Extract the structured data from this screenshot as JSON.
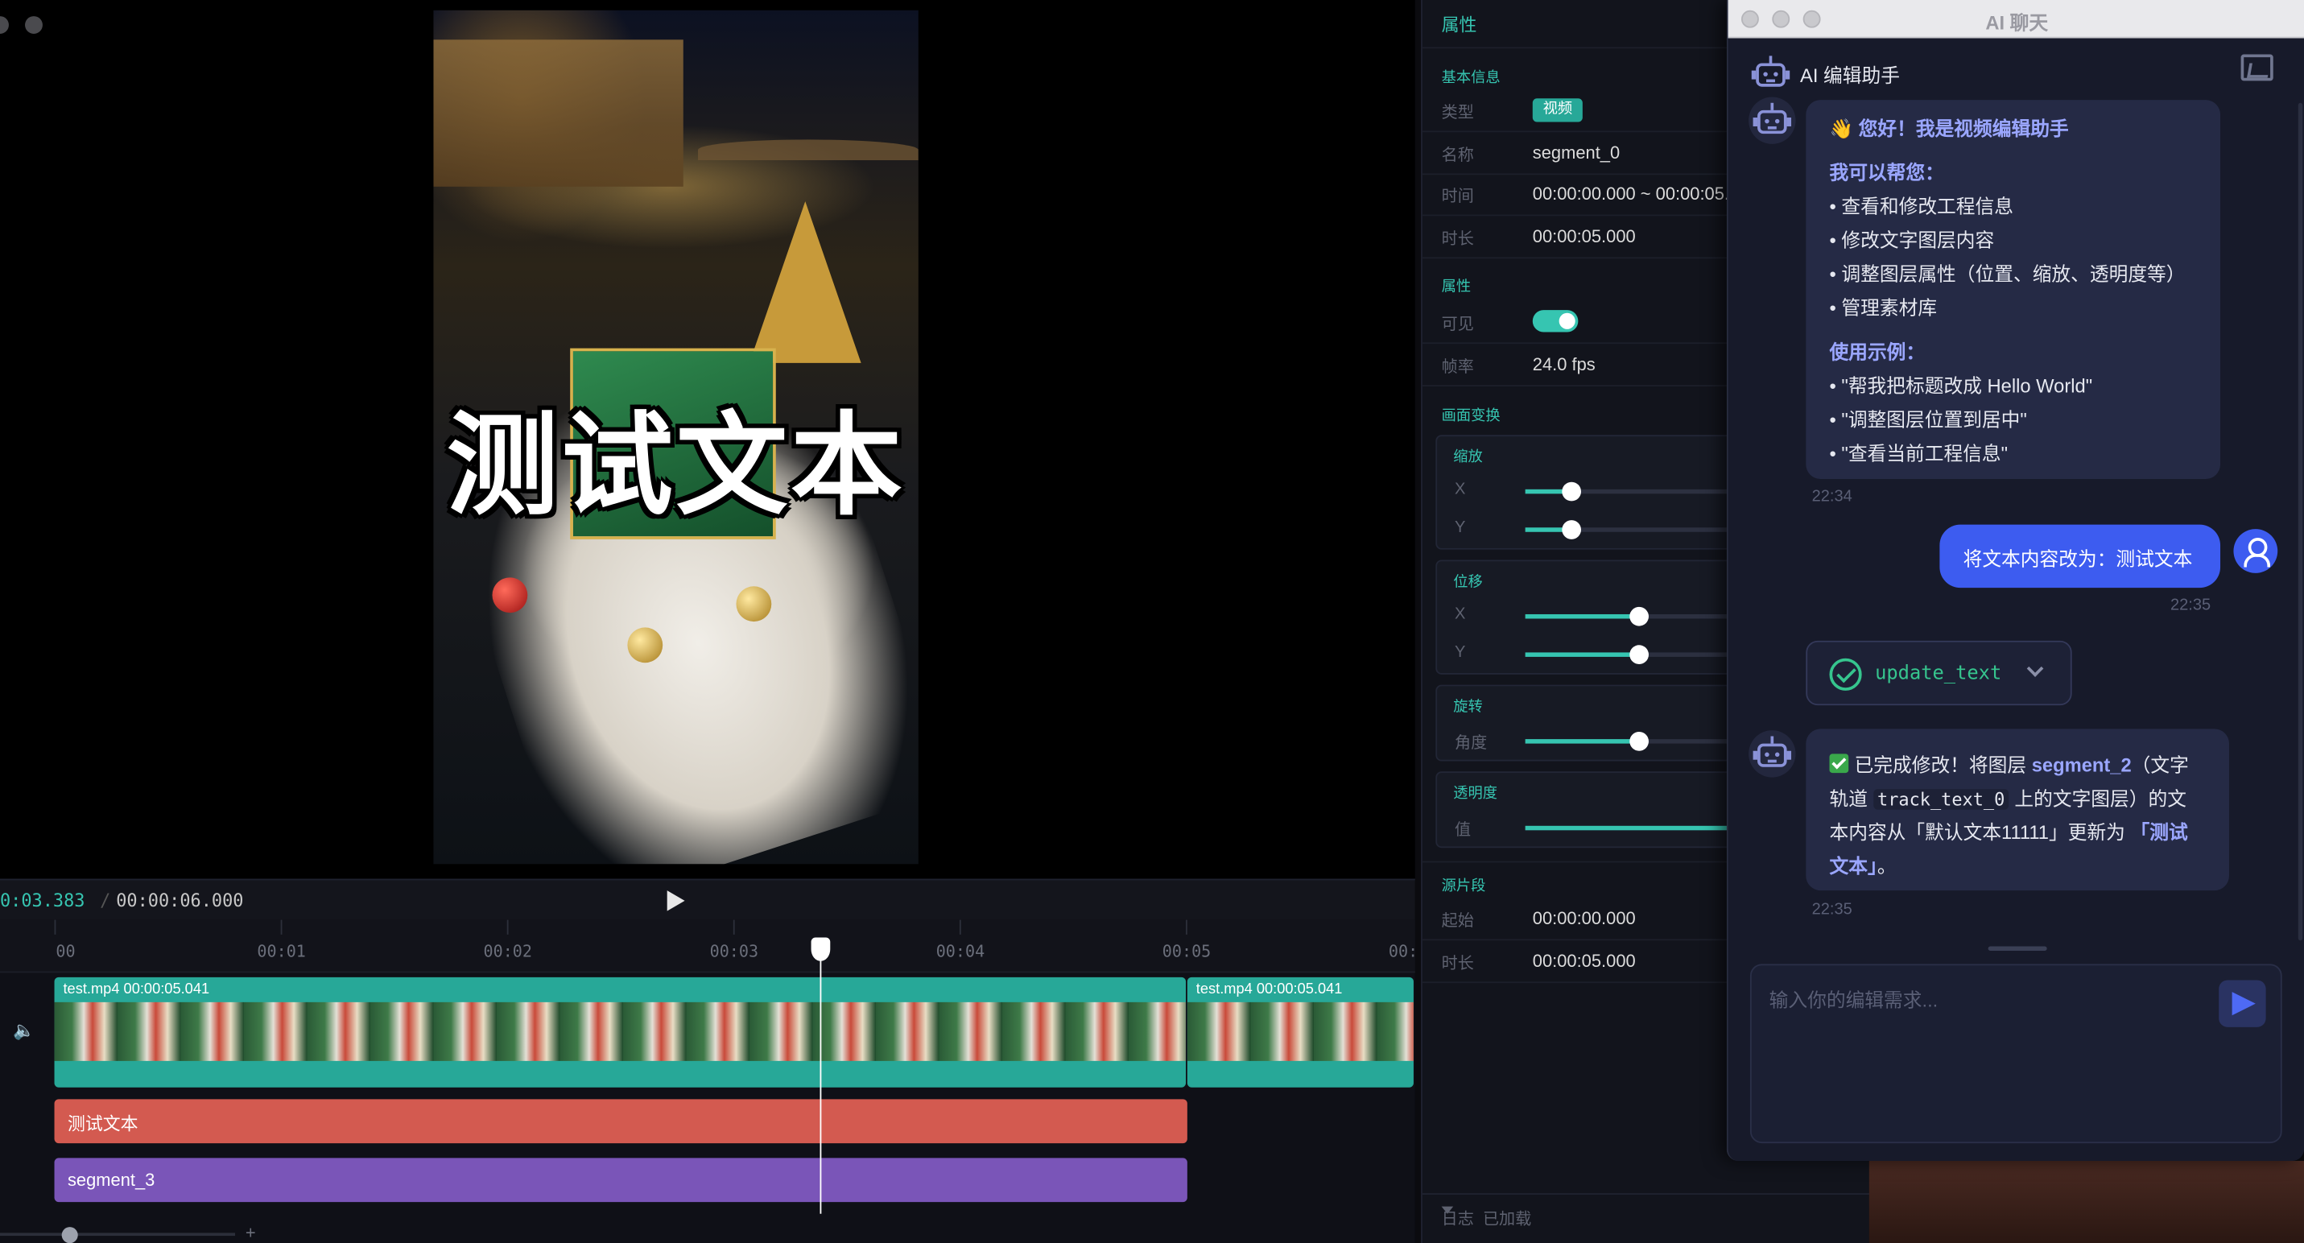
{
  "editor": {
    "overlay_text": "测试文本",
    "time_current": "0:03.383",
    "time_separator": "/",
    "time_total": "00:00:06.000",
    "ruler_ticks": [
      "00",
      "00:01",
      "00:02",
      "00:03",
      "00:04",
      "00:05",
      "00:"
    ],
    "clips": {
      "video_1_label": "test.mp4 00:00:05.041",
      "video_2_label": "test.mp4 00:00:05.041",
      "text_clip_label": "测试文本",
      "segment_clip_label": "segment_3"
    },
    "zoom_plus": "+",
    "speaker_icon": "🔈"
  },
  "properties": {
    "title": "属性",
    "basic_section": "基本信息",
    "type_label": "类型",
    "type_value": "视频",
    "name_label": "名称",
    "name_value": "segment_0",
    "time_label": "时间",
    "time_value": "00:00:00.000 ~ 00:00:05.",
    "duration_label": "时长",
    "duration_value": "00:00:05.000",
    "attr_section": "属性",
    "visible_label": "可见",
    "visible_on": true,
    "fps_label": "帧率",
    "fps_value": "24.0 fps",
    "transform_section": "画面变换",
    "scale_title": "缩放",
    "scale_x_label": "X",
    "scale_y_label": "Y",
    "scale_x_level": 0.13,
    "scale_y_level": 0.13,
    "position_title": "位移",
    "pos_x_label": "X",
    "pos_y_label": "Y",
    "pos_x_level": 0.32,
    "pos_y_level": 0.32,
    "rotate_title": "旋转",
    "rotate_label": "角度",
    "rotate_level": 0.32,
    "opacity_title": "透明度",
    "opacity_label": "值",
    "opacity_level": 1.0,
    "source_section": "源片段",
    "src_start_label": "起始",
    "src_start_value": "00:00:00.000",
    "src_duration_label": "时长",
    "src_duration_value": "00:00:05.000",
    "log_label": "日志",
    "log_status": "已加载"
  },
  "chat": {
    "window_title": "AI 聊天",
    "header_title": "AI 编辑助手",
    "msg1": {
      "greeting": "👋 您好！我是视频编辑助手",
      "help_heading": "我可以帮您：",
      "help_items": [
        "• 查看和修改工程信息",
        "• 修改文字图层内容",
        "• 调整图层属性（位置、缩放、透明度等）",
        "• 管理素材库"
      ],
      "example_heading": "使用示例：",
      "examples": [
        "• \"帮我把标题改成 Hello World\"",
        "• \"调整图层位置到居中\"",
        "• \"查看当前工程信息\""
      ],
      "time": "22:34"
    },
    "user_msg": {
      "text": "将文本内容改为：测试文本",
      "time": "22:35"
    },
    "tool_call": {
      "name": "update_text"
    },
    "msg2": {
      "line1_a": "已完成修改！将图层 ",
      "line1_b": "segment_2",
      "line1_c": "（文字",
      "line2_a": "轨道 ",
      "line2_b": "track_text_0",
      "line2_c": " 上的文字图层）的文",
      "line3_a": "本内容从「默认文本11111」更新为 ",
      "line3_b": "「测试",
      "line4_a": "文本」",
      "line4_b": "。",
      "time": "22:35"
    },
    "input_placeholder": "输入你的编辑需求..."
  }
}
